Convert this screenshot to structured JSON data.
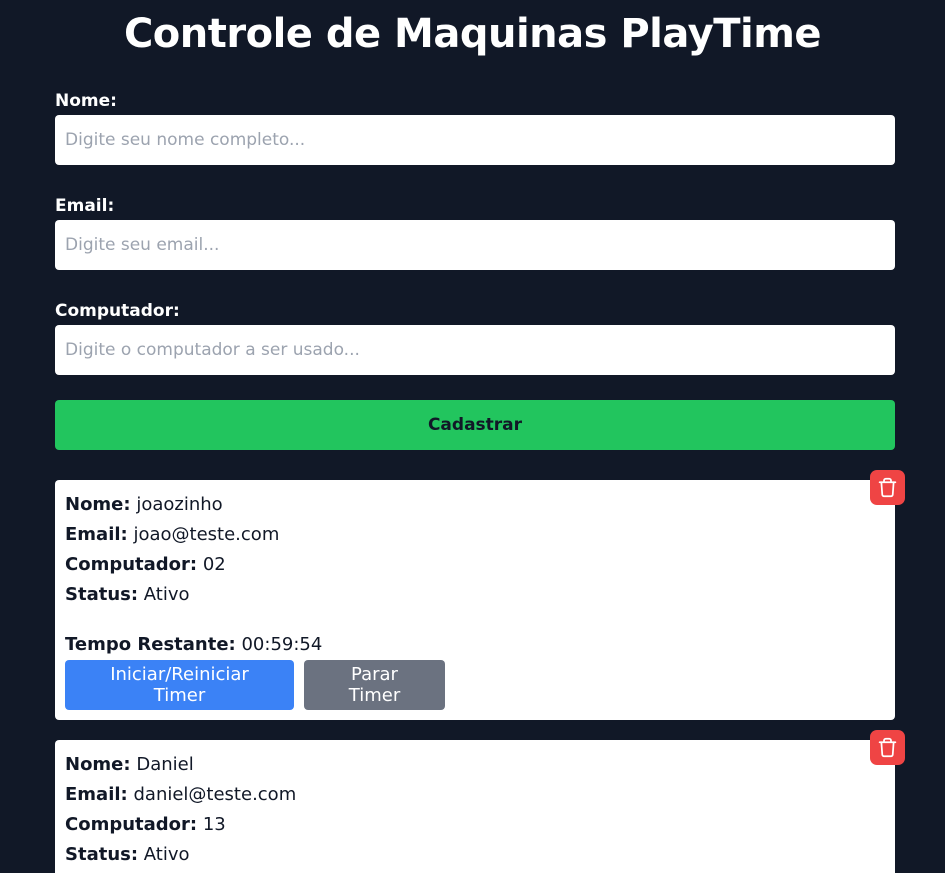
{
  "page": {
    "title": "Controle de Maquinas PlayTime"
  },
  "form": {
    "name_label": "Nome:",
    "name_placeholder": "Digite seu nome completo...",
    "name_value": "",
    "email_label": "Email:",
    "email_placeholder": "Digite seu email...",
    "email_value": "",
    "computer_label": "Computador:",
    "computer_placeholder": "Digite o computador a ser usado...",
    "computer_value": "",
    "submit_label": "Cadastrar"
  },
  "labels": {
    "name": "Nome:",
    "email": "Email:",
    "computer": "Computador:",
    "status": "Status:",
    "time_left": "Tempo Restante:",
    "start_button": "Iniciar/Reiniciar Timer",
    "stop_button": "Parar Timer"
  },
  "records": [
    {
      "name": "joaozinho",
      "email": "joao@teste.com",
      "computer": "02",
      "status": "Ativo",
      "time_left": "00:59:54"
    },
    {
      "name": "Daniel",
      "email": "daniel@teste.com",
      "computer": "13",
      "status": "Ativo"
    }
  ],
  "icons": {
    "delete": "trash-icon"
  },
  "colors": {
    "background": "#111827",
    "submit": "#22c55e",
    "delete": "#ef4444",
    "start": "#3b82f6",
    "stop": "#6b7280"
  }
}
